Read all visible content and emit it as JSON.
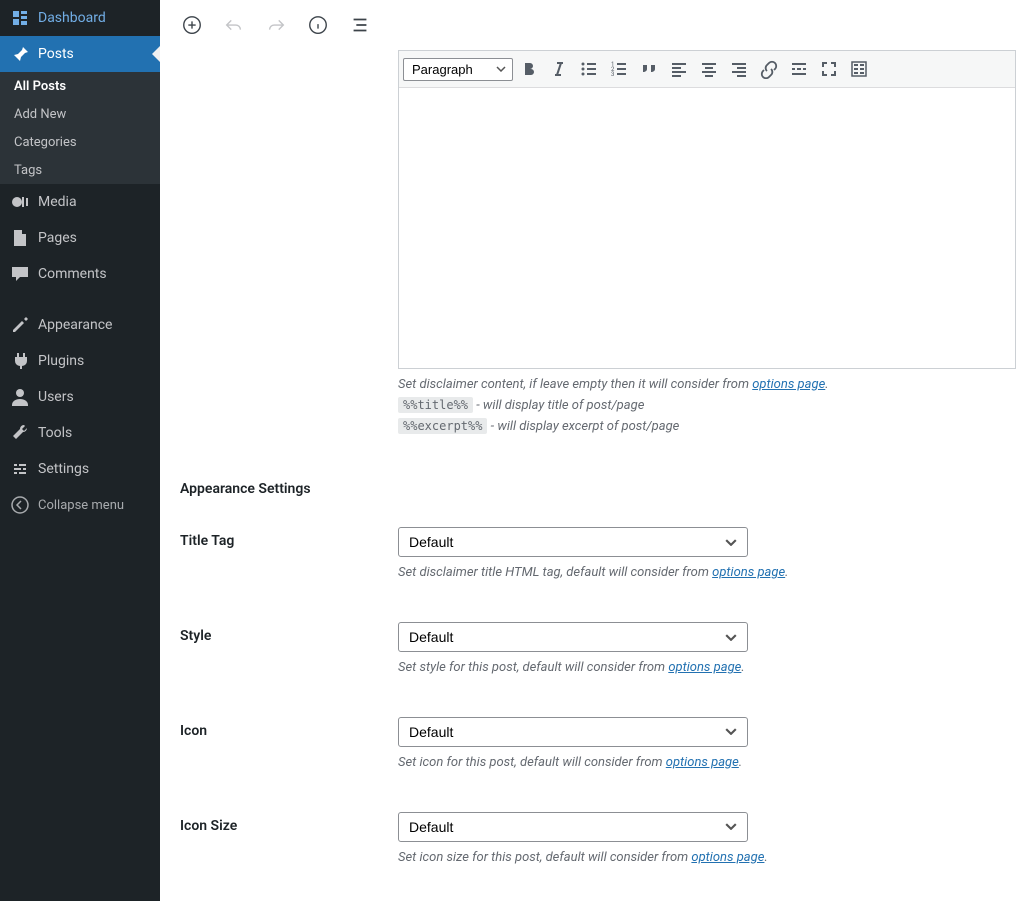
{
  "sidebar": {
    "dashboard": "Dashboard",
    "posts": "Posts",
    "submenu": {
      "all_posts": "All Posts",
      "add_new": "Add New",
      "categories": "Categories",
      "tags": "Tags"
    },
    "media": "Media",
    "pages": "Pages",
    "comments": "Comments",
    "appearance": "Appearance",
    "plugins": "Plugins",
    "users": "Users",
    "tools": "Tools",
    "settings": "Settings",
    "collapse": "Collapse menu"
  },
  "editor": {
    "format": "Paragraph"
  },
  "helper": {
    "content_prefix": "Set disclaimer content, if leave empty then it will consider from ",
    "options_link": "options page",
    "title_token": "%%title%%",
    "title_desc": " - will display title of post/page",
    "excerpt_token": "%%excerpt%%",
    "excerpt_desc": " - will display excerpt of post/page"
  },
  "section": {
    "appearance": "Appearance Settings"
  },
  "fields": {
    "title_tag": {
      "label": "Title Tag",
      "value": "Default",
      "help": "Set disclaimer title HTML tag, default will consider from "
    },
    "style": {
      "label": "Style",
      "value": "Default",
      "help": "Set style for this post, default will consider from "
    },
    "icon": {
      "label": "Icon",
      "value": "Default",
      "help": "Set icon for this post, default will consider from "
    },
    "icon_size": {
      "label": "Icon Size",
      "value": "Default",
      "help": "Set icon size for this post, default will consider from "
    }
  }
}
